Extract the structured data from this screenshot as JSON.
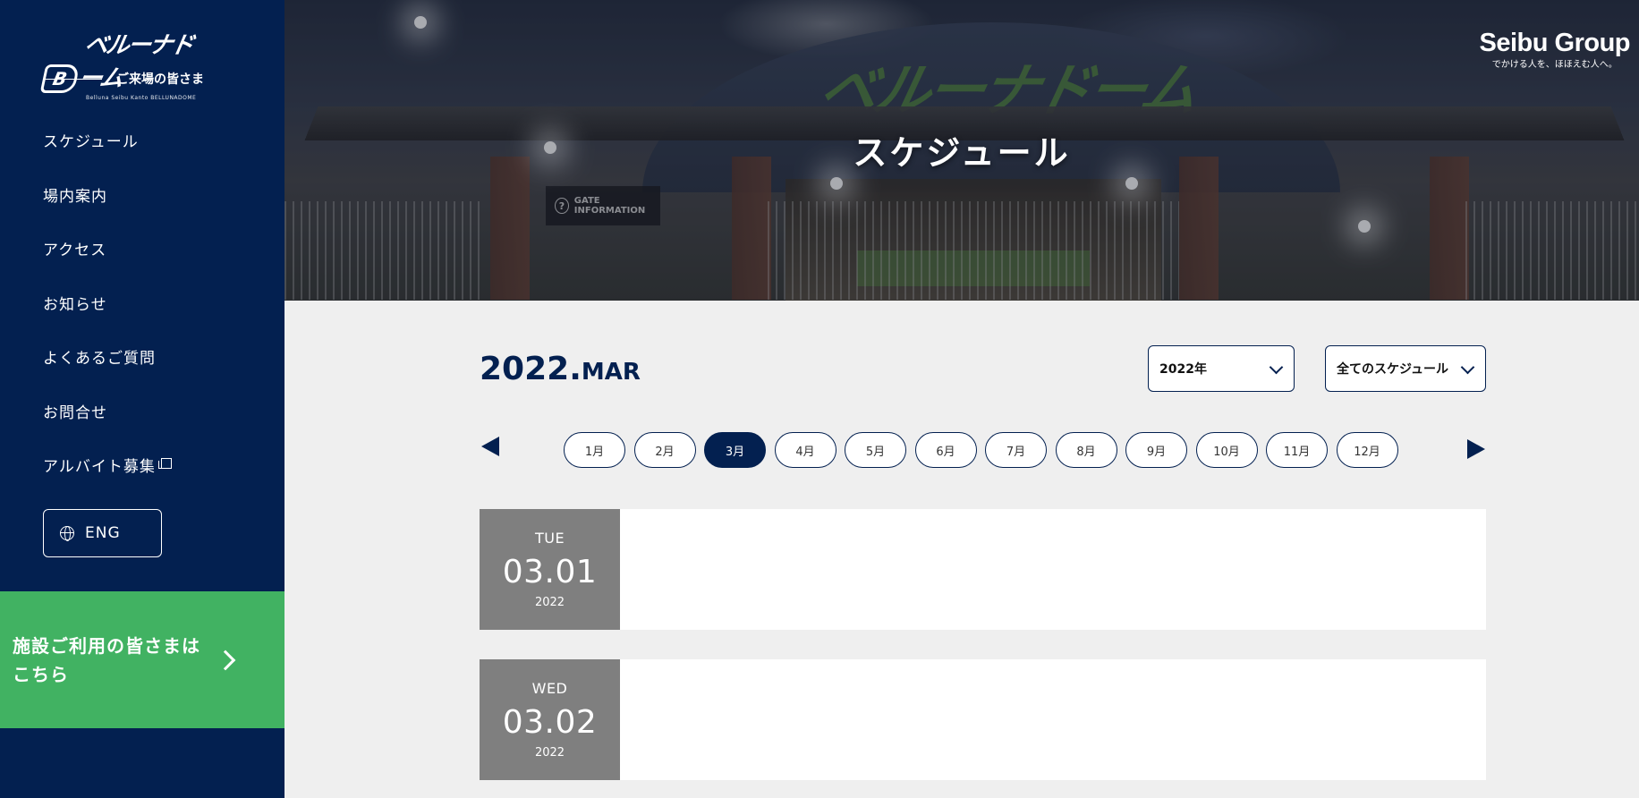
{
  "brand": {
    "logo_text": "ベルーナドーム",
    "logo_sub": "Belluna Seibu Kanto BELLUNADOME"
  },
  "visitor_label": "ご来場の皆さま",
  "nav": [
    {
      "label": "スケジュール"
    },
    {
      "label": "場内案内"
    },
    {
      "label": "アクセス"
    },
    {
      "label": "お知らせ"
    },
    {
      "label": "よくあるご質問"
    },
    {
      "label": "お問合せ"
    },
    {
      "label": "アルバイト募集",
      "icon": "external-link-icon"
    }
  ],
  "lang_button": {
    "label": "ENG",
    "icon": "globe-icon"
  },
  "facility_banner": {
    "label": "施設ご利用の皆さまはこちら",
    "icon": "chevron-right-icon",
    "color": "#41b262"
  },
  "hero": {
    "title": "スケジュール",
    "dome_text": "ベルーナドーム",
    "sign_text": "GATE INFORMATION",
    "seibu": {
      "name": "Seibu Group",
      "tagline": "でかける人を、ほほえむ人へ。"
    }
  },
  "schedule": {
    "year": "2022.",
    "month": "MAR",
    "year_select": "2022年",
    "type_select": "全てのスケジュール",
    "months": [
      "1月",
      "2月",
      "3月",
      "4月",
      "5月",
      "6月",
      "7月",
      "8月",
      "9月",
      "10月",
      "11月",
      "12月"
    ],
    "active_month": "3月",
    "days": [
      {
        "dow": "TUE",
        "date": "03.01",
        "year": "2022"
      },
      {
        "dow": "WED",
        "date": "03.02",
        "year": "2022"
      }
    ]
  },
  "colors": {
    "navy": "#032050",
    "green": "#41b262",
    "date_bg": "#7f7f7f",
    "page_bg": "#efefef"
  }
}
